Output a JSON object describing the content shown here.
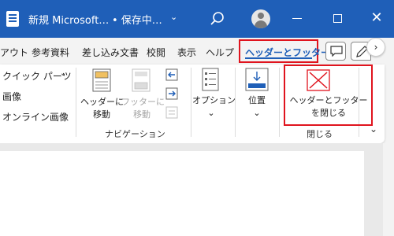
{
  "titlebar": {
    "doc_title": "新規 Microsoft…",
    "save_status": "• 保存中…",
    "chevron": "⌄",
    "close_glyph": "✕",
    "colors": {
      "background": "#1f5fb8",
      "text": "#ffffff"
    }
  },
  "tabs": {
    "items": [
      "アウト",
      "参考資料",
      "差し込み文書",
      "校閲",
      "表示",
      "ヘルプ"
    ],
    "active": "ヘッダーとフッター",
    "more_glyph": "›"
  },
  "ribbon": {
    "insert_group": {
      "items": [
        "クイック パーツ",
        "画像",
        "オンライン画像"
      ],
      "quick_parts_chevron": "⌄"
    },
    "navigation_group": {
      "goto_header": [
        "ヘッダーに",
        "移動"
      ],
      "goto_footer": [
        "フッターに",
        "移動"
      ],
      "label": "ナビゲーション"
    },
    "options": {
      "label": "オプション",
      "chevron": "⌄"
    },
    "position": {
      "label": "位置",
      "chevron": "⌄"
    },
    "close_group": {
      "button": [
        "ヘッダーとフッター",
        "を閉じる"
      ],
      "label": "閉じる"
    },
    "collapse_glyph": "⌄"
  },
  "colors": {
    "highlight_border": "#e0141e",
    "accent": "#1f5fb8",
    "close_x": "#e0141e"
  }
}
